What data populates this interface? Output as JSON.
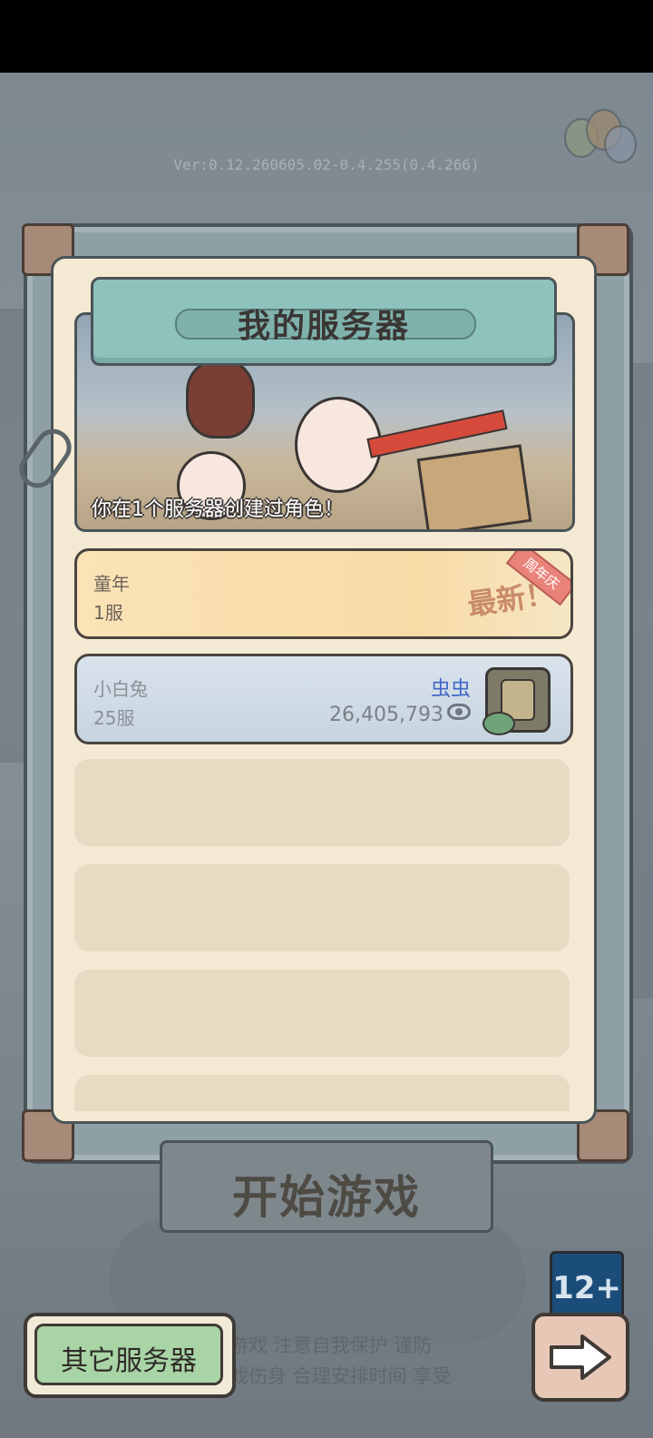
{
  "version": "Ver:0.12.260605.02-0.4.255(0.4.266)",
  "dialog": {
    "title": "我的服务器",
    "banner_caption": "你在1个服务器创建过角色！"
  },
  "servers": [
    {
      "name": "童年",
      "number": "1服",
      "tag": "最新！",
      "ribbon": "周年庆"
    },
    {
      "name": "小白兔",
      "number": "25服",
      "character": "虫虫",
      "score": "26,405,793"
    }
  ],
  "start_button": "开始游戏",
  "age_rating": "12+",
  "notice": {
    "line1": "版游戏  注意自我保护  谨防",
    "line2": "游戏伤身  合理安排时间  享受"
  },
  "other_servers_button": "其它服务器",
  "icons": {
    "next": "arrow-right-icon",
    "view": "eye-icon",
    "clip": "paperclip-icon"
  },
  "colors": {
    "title_plate": "#8ec2bd",
    "panel_bg": "#f4ead3",
    "character_name": "#3f66c6",
    "other_button": "#a9d4a6"
  }
}
